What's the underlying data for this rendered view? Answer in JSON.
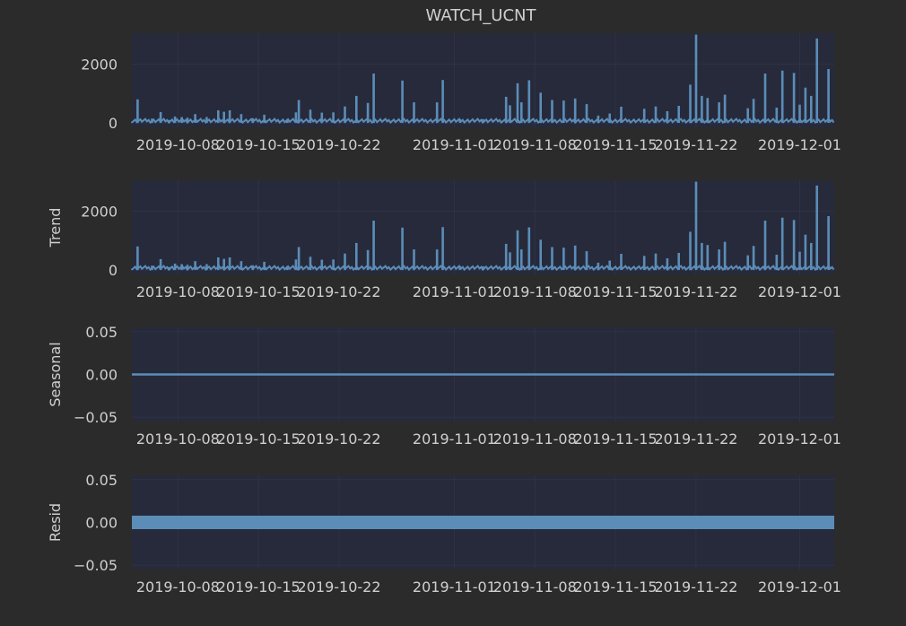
{
  "figure": {
    "title": "WATCH_UCNT",
    "background": "#2b2b2b",
    "panel_color": "#272a3a",
    "grid_color": "#2f3245",
    "text_color": "#cfcfcf",
    "series_color": "#5b8db8"
  },
  "chart_data": [
    {
      "type": "line",
      "title": "WATCH_UCNT",
      "xlabel": "",
      "ylabel": "",
      "ylim": [
        -150,
        3050
      ],
      "yticks": [
        0,
        2000
      ],
      "ytick_labels": [
        "0",
        "2000"
      ],
      "x_axis_type": "date",
      "xlim": [
        "2019-10-04",
        "2019-12-04"
      ],
      "xticks": [
        "2019-10-08",
        "2019-10-15",
        "2019-10-22",
        "2019-11-01",
        "2019-11-08",
        "2019-11-15",
        "2019-11-22",
        "2019-12-01"
      ],
      "xtick_labels": [
        "2019-10-08",
        "2019-10-15",
        "2019-10-22",
        "2019-11-01",
        "2019-11-08",
        "2019-11-15",
        "2019-11-22",
        "2019-12-01"
      ],
      "grid": true,
      "series": [
        {
          "name": "",
          "spikes": [
            [
              "2019-10-04T12",
              800
            ],
            [
              "2019-10-05T18",
              150
            ],
            [
              "2019-10-06T12",
              370
            ],
            [
              "2019-10-07T06",
              100
            ],
            [
              "2019-10-07T18",
              220
            ],
            [
              "2019-10-08T08",
              200
            ],
            [
              "2019-10-08T20",
              180
            ],
            [
              "2019-10-09T12",
              300
            ],
            [
              "2019-10-10T12",
              200
            ],
            [
              "2019-10-11T12",
              430
            ],
            [
              "2019-10-12T00",
              380
            ],
            [
              "2019-10-12T12",
              430
            ],
            [
              "2019-10-13T12",
              300
            ],
            [
              "2019-10-14T12",
              160
            ],
            [
              "2019-10-15T12",
              280
            ],
            [
              "2019-10-17T12",
              130
            ],
            [
              "2019-10-18T06",
              360
            ],
            [
              "2019-10-18T12",
              780
            ],
            [
              "2019-10-19T12",
              450
            ],
            [
              "2019-10-20T12",
              350
            ],
            [
              "2019-10-21T12",
              360
            ],
            [
              "2019-10-22T12",
              560
            ],
            [
              "2019-10-23T12",
              920
            ],
            [
              "2019-10-24T12",
              680
            ],
            [
              "2019-10-25T00",
              1680
            ],
            [
              "2019-10-27T12",
              1440
            ],
            [
              "2019-10-28T12",
              700
            ],
            [
              "2019-10-30T12",
              700
            ],
            [
              "2019-10-31T00",
              1460
            ],
            [
              "2019-11-01T12",
              120
            ],
            [
              "2019-11-03T12",
              130
            ],
            [
              "2019-11-05T12",
              890
            ],
            [
              "2019-11-05T20",
              600
            ],
            [
              "2019-11-06T12",
              1350
            ],
            [
              "2019-11-06T20",
              700
            ],
            [
              "2019-11-07T12",
              1450
            ],
            [
              "2019-11-08T12",
              1030
            ],
            [
              "2019-11-09T12",
              780
            ],
            [
              "2019-11-10T12",
              760
            ],
            [
              "2019-11-11T12",
              830
            ],
            [
              "2019-11-12T12",
              640
            ],
            [
              "2019-11-13T12",
              250
            ],
            [
              "2019-11-14T12",
              320
            ],
            [
              "2019-11-15T12",
              550
            ],
            [
              "2019-11-17T12",
              480
            ],
            [
              "2019-11-18T12",
              560
            ],
            [
              "2019-11-19T12",
              400
            ],
            [
              "2019-11-20T12",
              580
            ],
            [
              "2019-11-21T12",
              1300
            ],
            [
              "2019-11-22T00",
              3000
            ],
            [
              "2019-11-22T12",
              920
            ],
            [
              "2019-11-23T00",
              850
            ],
            [
              "2019-11-24T00",
              700
            ],
            [
              "2019-11-24T12",
              960
            ],
            [
              "2019-11-26T12",
              500
            ],
            [
              "2019-11-27T00",
              820
            ],
            [
              "2019-11-28T00",
              1680
            ],
            [
              "2019-11-29T00",
              520
            ],
            [
              "2019-11-29T12",
              1780
            ],
            [
              "2019-11-30T12",
              1700
            ],
            [
              "2019-12-01T00",
              620
            ],
            [
              "2019-12-01T12",
              1200
            ],
            [
              "2019-12-02T00",
              920
            ],
            [
              "2019-12-02T12",
              2870
            ],
            [
              "2019-12-03T12",
              1830
            ]
          ]
        }
      ]
    },
    {
      "type": "line",
      "title": "",
      "xlabel": "",
      "ylabel": "Trend",
      "ylim": [
        -150,
        3050
      ],
      "yticks": [
        0,
        2000
      ],
      "ytick_labels": [
        "0",
        "2000"
      ],
      "x_axis_type": "date",
      "xlim": [
        "2019-10-04",
        "2019-12-04"
      ],
      "xticks": [
        "2019-10-08",
        "2019-10-15",
        "2019-10-22",
        "2019-11-01",
        "2019-11-08",
        "2019-11-15",
        "2019-11-22",
        "2019-12-01"
      ],
      "xtick_labels": [
        "2019-10-08",
        "2019-10-15",
        "2019-10-22",
        "2019-11-01",
        "2019-11-08",
        "2019-11-15",
        "2019-11-22",
        "2019-12-01"
      ],
      "grid": true,
      "series": [
        {
          "name": "",
          "spikes": [
            [
              "2019-10-04T12",
              800
            ],
            [
              "2019-10-05T18",
              150
            ],
            [
              "2019-10-06T12",
              370
            ],
            [
              "2019-10-07T06",
              100
            ],
            [
              "2019-10-07T18",
              220
            ],
            [
              "2019-10-08T08",
              200
            ],
            [
              "2019-10-08T20",
              180
            ],
            [
              "2019-10-09T12",
              300
            ],
            [
              "2019-10-10T12",
              200
            ],
            [
              "2019-10-11T12",
              430
            ],
            [
              "2019-10-12T00",
              380
            ],
            [
              "2019-10-12T12",
              430
            ],
            [
              "2019-10-13T12",
              300
            ],
            [
              "2019-10-14T12",
              160
            ],
            [
              "2019-10-15T12",
              280
            ],
            [
              "2019-10-17T12",
              130
            ],
            [
              "2019-10-18T06",
              360
            ],
            [
              "2019-10-18T12",
              780
            ],
            [
              "2019-10-19T12",
              450
            ],
            [
              "2019-10-20T12",
              350
            ],
            [
              "2019-10-21T12",
              360
            ],
            [
              "2019-10-22T12",
              560
            ],
            [
              "2019-10-23T12",
              920
            ],
            [
              "2019-10-24T12",
              680
            ],
            [
              "2019-10-25T00",
              1680
            ],
            [
              "2019-10-27T12",
              1440
            ],
            [
              "2019-10-28T12",
              700
            ],
            [
              "2019-10-30T12",
              700
            ],
            [
              "2019-10-31T00",
              1460
            ],
            [
              "2019-11-01T12",
              120
            ],
            [
              "2019-11-03T12",
              130
            ],
            [
              "2019-11-05T12",
              890
            ],
            [
              "2019-11-05T20",
              600
            ],
            [
              "2019-11-06T12",
              1350
            ],
            [
              "2019-11-06T20",
              700
            ],
            [
              "2019-11-07T12",
              1450
            ],
            [
              "2019-11-08T12",
              1030
            ],
            [
              "2019-11-09T12",
              780
            ],
            [
              "2019-11-10T12",
              760
            ],
            [
              "2019-11-11T12",
              830
            ],
            [
              "2019-11-12T12",
              640
            ],
            [
              "2019-11-13T12",
              250
            ],
            [
              "2019-11-14T12",
              320
            ],
            [
              "2019-11-15T12",
              550
            ],
            [
              "2019-11-17T12",
              480
            ],
            [
              "2019-11-18T12",
              560
            ],
            [
              "2019-11-19T12",
              400
            ],
            [
              "2019-11-20T12",
              580
            ],
            [
              "2019-11-21T12",
              1300
            ],
            [
              "2019-11-22T00",
              3000
            ],
            [
              "2019-11-22T12",
              920
            ],
            [
              "2019-11-23T00",
              850
            ],
            [
              "2019-11-24T00",
              700
            ],
            [
              "2019-11-24T12",
              960
            ],
            [
              "2019-11-26T12",
              500
            ],
            [
              "2019-11-27T00",
              820
            ],
            [
              "2019-11-28T00",
              1680
            ],
            [
              "2019-11-29T00",
              520
            ],
            [
              "2019-11-29T12",
              1780
            ],
            [
              "2019-11-30T12",
              1700
            ],
            [
              "2019-12-01T00",
              620
            ],
            [
              "2019-12-01T12",
              1200
            ],
            [
              "2019-12-02T00",
              920
            ],
            [
              "2019-12-02T12",
              2870
            ],
            [
              "2019-12-03T12",
              1830
            ]
          ]
        }
      ]
    },
    {
      "type": "line",
      "title": "",
      "xlabel": "",
      "ylabel": "Seasonal",
      "ylim": [
        -0.055,
        0.055
      ],
      "yticks": [
        0.05,
        0,
        -0.05
      ],
      "ytick_labels": [
        "0.05",
        "0.00",
        "−0.05"
      ],
      "x_axis_type": "date",
      "xlim": [
        "2019-10-04",
        "2019-12-04"
      ],
      "xticks": [
        "2019-10-08",
        "2019-10-15",
        "2019-10-22",
        "2019-11-01",
        "2019-11-08",
        "2019-11-15",
        "2019-11-22",
        "2019-12-01"
      ],
      "xtick_labels": [
        "2019-10-08",
        "2019-10-15",
        "2019-10-22",
        "2019-11-01",
        "2019-11-08",
        "2019-11-15",
        "2019-11-22",
        "2019-12-01"
      ],
      "grid": true,
      "series": [
        {
          "name": "",
          "x": [
            "2019-10-04",
            "2019-12-04"
          ],
          "y": [
            0,
            0
          ]
        }
      ]
    },
    {
      "type": "scatter",
      "title": "",
      "xlabel": "",
      "ylabel": "Resid",
      "ylim": [
        -0.055,
        0.055
      ],
      "yticks": [
        0.05,
        0,
        -0.05
      ],
      "ytick_labels": [
        "0.05",
        "0.00",
        "−0.05"
      ],
      "x_axis_type": "date",
      "xlim": [
        "2019-10-04",
        "2019-12-04"
      ],
      "xticks": [
        "2019-10-08",
        "2019-10-15",
        "2019-10-22",
        "2019-11-01",
        "2019-11-08",
        "2019-11-15",
        "2019-11-22",
        "2019-12-01"
      ],
      "xtick_labels": [
        "2019-10-08",
        "2019-10-15",
        "2019-10-22",
        "2019-11-01",
        "2019-11-08",
        "2019-11-15",
        "2019-11-22",
        "2019-12-01"
      ],
      "grid": true,
      "series": [
        {
          "name": "",
          "x": [
            "2019-10-04",
            "2019-12-04"
          ],
          "y": [
            0,
            0
          ]
        }
      ]
    }
  ]
}
